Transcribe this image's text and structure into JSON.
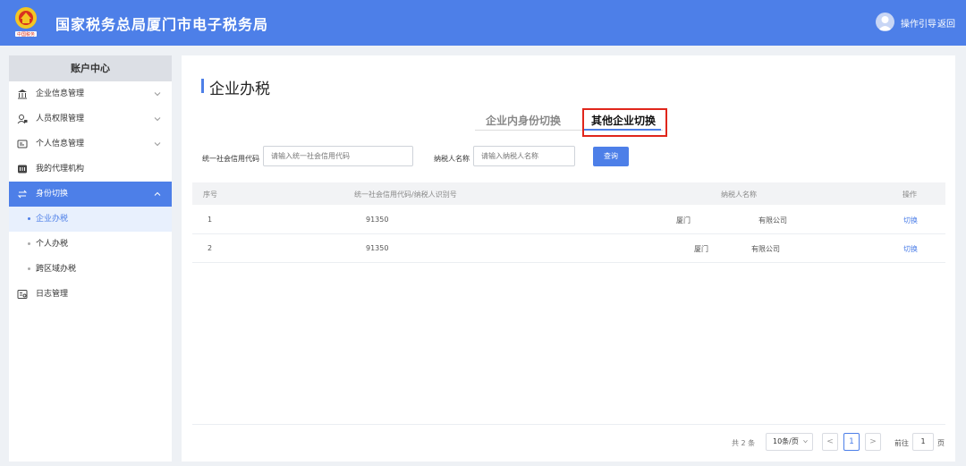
{
  "header": {
    "title": "国家税务总局厦门市电子税务局",
    "guide_label": "操作引导",
    "back_label": "返回",
    "emblem_text": "中国税务"
  },
  "sidebar": {
    "title": "账户中心",
    "items": [
      {
        "label": "企业信息管理",
        "icon": "bank-icon",
        "expandable": true
      },
      {
        "label": "人员权限管理",
        "icon": "user-lock-icon",
        "expandable": true
      },
      {
        "label": "个人信息管理",
        "icon": "id-card-icon",
        "expandable": true
      },
      {
        "label": "我的代理机构",
        "icon": "agency-icon",
        "expandable": false
      },
      {
        "label": "身份切换",
        "icon": "switch-icon",
        "expandable": true,
        "expanded": true,
        "active": true
      },
      {
        "label": "日志管理",
        "icon": "log-icon",
        "expandable": false
      }
    ],
    "sub_items": [
      {
        "label": "企业办税",
        "active": true
      },
      {
        "label": "个人办税"
      },
      {
        "label": "跨区域办税"
      }
    ]
  },
  "main": {
    "page_title": "企业办税",
    "tabs": [
      {
        "label": "企业内身份切换",
        "active": false
      },
      {
        "label": "其他企业切换",
        "active": true
      }
    ],
    "search": {
      "code_label": "统一社会信用代码",
      "code_placeholder": "请输入统一社会信用代码",
      "name_label": "纳税人名称",
      "name_placeholder": "请输入纳税人名称",
      "query_button": "查询"
    },
    "table": {
      "columns": [
        "序号",
        "统一社会信用代码/纳税人识别号",
        "纳税人名称",
        "操作"
      ],
      "rows": [
        {
          "index": "1",
          "code": "91350",
          "name_prefix": "厦门",
          "name_suffix": "有限公司",
          "action": "切换"
        },
        {
          "index": "2",
          "code": "91350",
          "name_prefix": "厦门",
          "name_suffix": "有限公司",
          "action": "切换"
        }
      ]
    },
    "pagination": {
      "total": "共 2 条",
      "page_size": "10条/页",
      "prev": "<",
      "current_page": "1",
      "next": ">",
      "goto_label": "前往",
      "goto_value": "1",
      "page_unit": "页"
    }
  },
  "colors": {
    "primary": "#4d7fe8",
    "highlight": "#e0261b"
  }
}
